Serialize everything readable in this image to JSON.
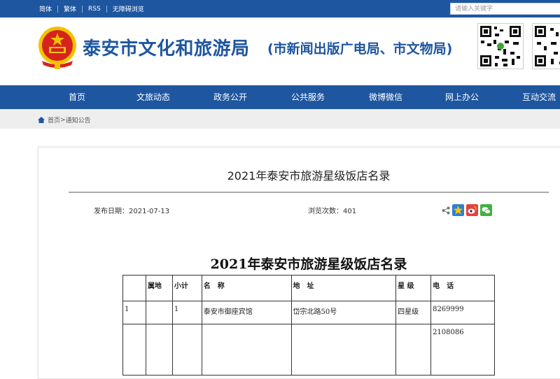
{
  "topbar": {
    "links": [
      "简体",
      "繁体",
      "RSS",
      "无障碍浏览"
    ],
    "search_placeholder": "请输入关键字"
  },
  "header": {
    "title": "泰安市文化和旅游局",
    "subtitle": "(市新闻出版广电局、市文物局)"
  },
  "nav": {
    "items": [
      "首页",
      "文旅动态",
      "政务公开",
      "公共服务",
      "微博微信",
      "网上办公",
      "互动交流"
    ]
  },
  "breadcrumb": {
    "home": "首页",
    "separator": ">",
    "current": "通知公告"
  },
  "article": {
    "title": "2021年泰安市旅游星级饭店名录",
    "publish_label": "发布日期：",
    "publish_date": "2021-07-13",
    "views_label": "浏览次数：",
    "views": "401"
  },
  "document": {
    "title": "2021年泰安市旅游星级饭店名录",
    "columns": [
      "",
      "属地",
      "小计",
      "名　称",
      "地　址",
      "星 级",
      "电　话"
    ],
    "rows": [
      [
        "1",
        "",
        "1",
        "泰安市御座宾馆",
        "岱宗北路50号",
        "四星级",
        "8269999"
      ],
      [
        "",
        "",
        "",
        "",
        "",
        "",
        "2108086"
      ]
    ]
  },
  "colors": {
    "brand_blue": "#1e56a0",
    "emblem_red": "#d6231e",
    "emblem_gold": "#f2c200"
  }
}
